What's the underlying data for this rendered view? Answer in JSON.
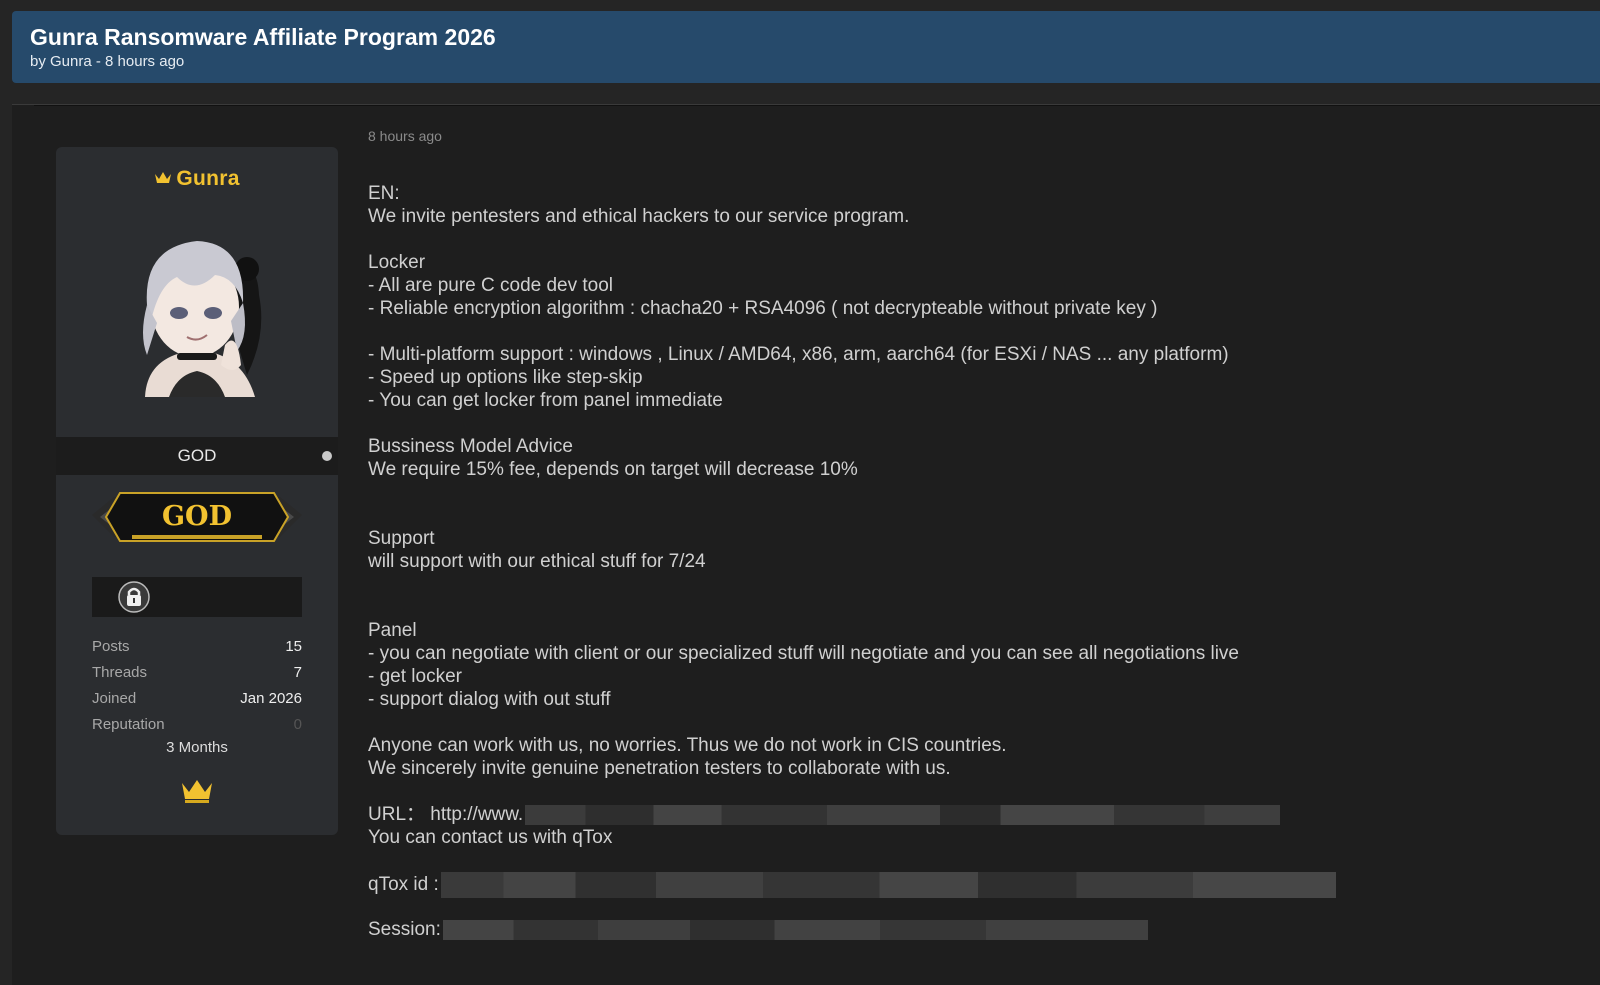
{
  "thread": {
    "title": "Gunra Ransomware Affiliate Program 2026",
    "byline": "by Gunra - 8 hours ago"
  },
  "profile": {
    "username": "Gunra",
    "rank": "GOD",
    "badge_text": "GOD",
    "stats": [
      {
        "label": "Posts",
        "value": "15"
      },
      {
        "label": "Threads",
        "value": "7"
      },
      {
        "label": "Joined",
        "value": "Jan 2026"
      },
      {
        "label": "Reputation",
        "value": "0"
      }
    ],
    "tenure": "3 Months",
    "colors": {
      "username": "#f2c230",
      "header": "#264a6b"
    }
  },
  "post": {
    "date": "8 hours ago",
    "lines": [
      "EN:",
      "We invite pentesters and ethical hackers to our service program.",
      "",
      "Locker",
      "- All are pure C code dev tool",
      "- Reliable encryption algorithm : chacha20 + RSA4096 ( not decrypteable without private key )",
      "",
      "- Multi-platform support : windows , Linux / AMD64, x86, arm, aarch64 (for ESXi / NAS ... any platform)",
      "- Speed up options like step-skip",
      "- You can get locker from panel immediate",
      "",
      "Bussiness Model Advice",
      "We require 15% fee, depends on target will decrease 10%",
      "",
      "",
      "Support",
      "will support with our ethical stuff for 7/24",
      "",
      "",
      "Panel",
      "- you can negotiate with client or our specialized stuff will negotiate and you can see all negotiations live",
      "- get locker",
      "- support dialog with out stuff",
      "",
      "Anyone can work with us, no worries. Thus we do not work in CIS countries.",
      "We sincerely invite genuine penetration testers to collaborate with us.",
      "",
      "URL： http://www.",
      "You can contact us with qTox",
      "",
      "qTox id :",
      "",
      "Session:"
    ]
  }
}
